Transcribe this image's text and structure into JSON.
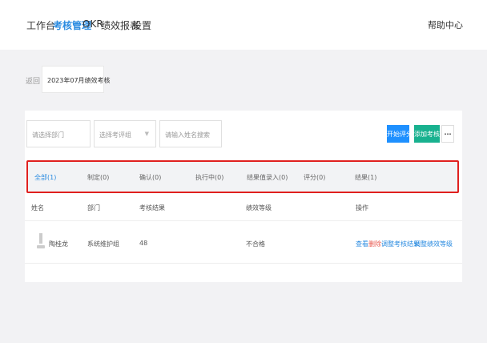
{
  "nav": {
    "items": [
      "工作台",
      "考核管理",
      "OKR",
      "绩效报表",
      "设置"
    ],
    "active": "考核管理",
    "help": "帮助中心"
  },
  "period": {
    "back": "返回",
    "name": "2023年07月绩效考核"
  },
  "filters": {
    "department_placeholder": "请选择部门",
    "group_placeholder": "选择考评组",
    "search_placeholder": "请输入姓名搜索"
  },
  "buttons": {
    "start": "开始评分",
    "add": "添加考核人",
    "more": "..."
  },
  "status_tabs": [
    {
      "label": "全部(1)",
      "active": true
    },
    {
      "label": "制定(0)",
      "active": false
    },
    {
      "label": "确认(0)",
      "active": false
    },
    {
      "label": "执行中(0)",
      "active": false
    },
    {
      "label": "结果值录入(0)",
      "active": false
    },
    {
      "label": "评分(0)",
      "active": false
    },
    {
      "label": "结果(1)",
      "active": false
    }
  ],
  "table": {
    "headers": [
      "姓名",
      "部门",
      "考核结果",
      "绩效等级",
      "操作"
    ],
    "rows": [
      {
        "name": "陶桂龙",
        "department": "系统维护组",
        "result": "48",
        "grade": "不合格",
        "actions": [
          "查看",
          "删除",
          "调整考核结果",
          "调整绩效等级"
        ]
      }
    ]
  },
  "colors": {
    "accent": "#2a8be0",
    "primary_button": "#1e90ff",
    "add_button": "#18b18f",
    "highlight_border": "#e0201e",
    "delete": "#e8584f"
  }
}
